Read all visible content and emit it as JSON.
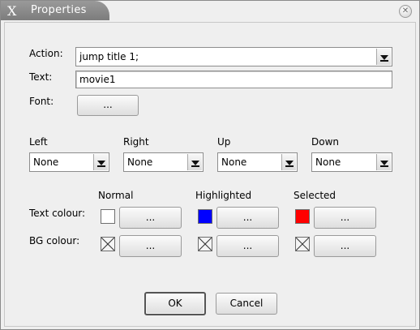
{
  "window": {
    "title": "Properties"
  },
  "form": {
    "action_label": "Action:",
    "action_value": "jump title 1;",
    "text_label": "Text:",
    "text_value": "movie1",
    "font_label": "Font:",
    "font_button": "..."
  },
  "navigation": [
    {
      "label": "Left",
      "value": "None"
    },
    {
      "label": "Right",
      "value": "None"
    },
    {
      "label": "Up",
      "value": "None"
    },
    {
      "label": "Down",
      "value": "None"
    }
  ],
  "colours": {
    "columns": [
      "Normal",
      "Highlighted",
      "Selected"
    ],
    "text_colour_label": "Text colour:",
    "bg_colour_label": "BG colour:",
    "button_label": "...",
    "text_colour_swatches": [
      "#ffffff",
      "#0000ff",
      "#ff0000"
    ]
  },
  "actions": {
    "ok_label": "OK",
    "cancel_label": "Cancel"
  }
}
